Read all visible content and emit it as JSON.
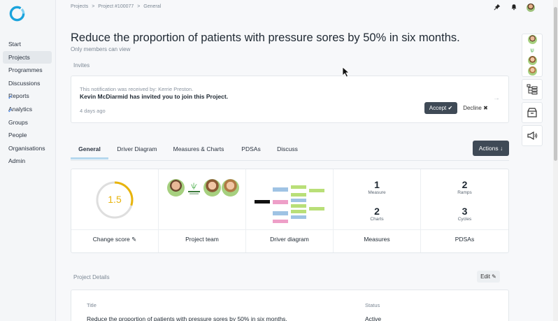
{
  "sidebar": {
    "items": [
      {
        "label": "Start"
      },
      {
        "label": "Projects",
        "active": true
      },
      {
        "label": "Programmes"
      },
      {
        "label": "Discussions"
      },
      {
        "label": "Reports"
      },
      {
        "label": "Analytics"
      },
      {
        "label": "Groups"
      },
      {
        "label": "People"
      },
      {
        "label": "Organisations"
      },
      {
        "label": "Admin"
      }
    ]
  },
  "breadcrumb": [
    "Projects",
    ">",
    "Project #100077",
    ">",
    "General"
  ],
  "header": {
    "title": "Reduce the proportion of patients with pressure sores by 50% in six months.",
    "visibility": "Only members can view"
  },
  "invites": {
    "section_label": "Invites",
    "received_by": "This notification was received by: Kerrie Preston.",
    "message": "Kevin McDiarmid has invited you to join this Project.",
    "time": "4 days ago",
    "accept_label": "Accept",
    "decline_label": "Decline"
  },
  "tabs": [
    "General",
    "Driver Diagram",
    "Measures & Charts",
    "PDSAs",
    "Discuss"
  ],
  "actions_label": "Actions",
  "summary": {
    "change_score": {
      "value": "1.5",
      "label": "Change score",
      "fraction": 0.3
    },
    "team": {
      "label": "Project team"
    },
    "driver": {
      "label": "Driver diagram"
    },
    "measures": {
      "measure_num": "1",
      "measure_lbl": "Measure",
      "charts_num": "2",
      "charts_lbl": "Charts",
      "label": "Measures"
    },
    "pdsas": {
      "ramps_num": "2",
      "ramps_lbl": "Ramps",
      "cycles_num": "3",
      "cycles_lbl": "Cycles",
      "label": "PDSAs"
    }
  },
  "details": {
    "section_label": "Project Details",
    "edit_label": "Edit",
    "title_label": "Title",
    "title_value": "Reduce the proportion of patients with pressure sores by 50% in six months.",
    "status_label": "Status",
    "status_value": "Active"
  },
  "colors": {
    "accent": "#e8b40b",
    "dark_button": "#3f4a56",
    "tab_underline": "#b6d8ee"
  }
}
